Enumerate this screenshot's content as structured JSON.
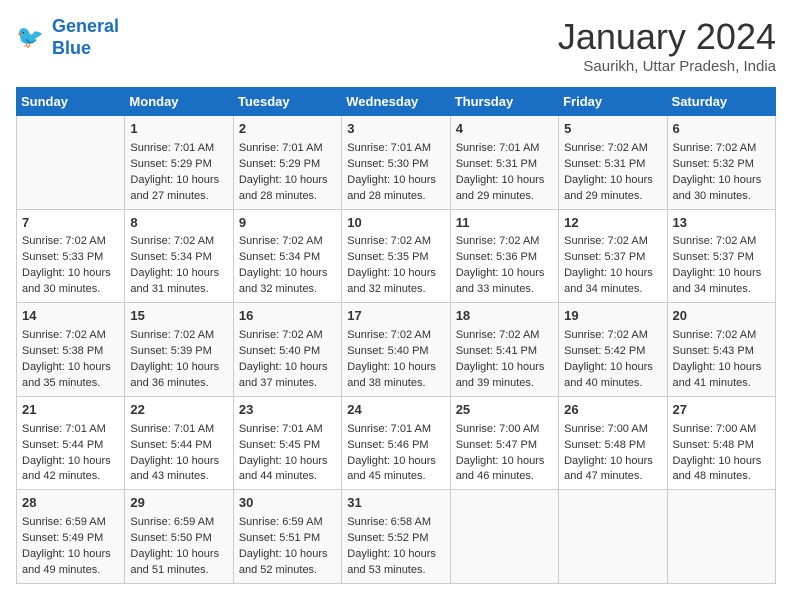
{
  "header": {
    "logo_line1": "General",
    "logo_line2": "Blue",
    "month": "January 2024",
    "location": "Saurikh, Uttar Pradesh, India"
  },
  "weekdays": [
    "Sunday",
    "Monday",
    "Tuesday",
    "Wednesday",
    "Thursday",
    "Friday",
    "Saturday"
  ],
  "weeks": [
    [
      {
        "day": "",
        "info": ""
      },
      {
        "day": "1",
        "info": "Sunrise: 7:01 AM\nSunset: 5:29 PM\nDaylight: 10 hours\nand 27 minutes."
      },
      {
        "day": "2",
        "info": "Sunrise: 7:01 AM\nSunset: 5:29 PM\nDaylight: 10 hours\nand 28 minutes."
      },
      {
        "day": "3",
        "info": "Sunrise: 7:01 AM\nSunset: 5:30 PM\nDaylight: 10 hours\nand 28 minutes."
      },
      {
        "day": "4",
        "info": "Sunrise: 7:01 AM\nSunset: 5:31 PM\nDaylight: 10 hours\nand 29 minutes."
      },
      {
        "day": "5",
        "info": "Sunrise: 7:02 AM\nSunset: 5:31 PM\nDaylight: 10 hours\nand 29 minutes."
      },
      {
        "day": "6",
        "info": "Sunrise: 7:02 AM\nSunset: 5:32 PM\nDaylight: 10 hours\nand 30 minutes."
      }
    ],
    [
      {
        "day": "7",
        "info": "Sunrise: 7:02 AM\nSunset: 5:33 PM\nDaylight: 10 hours\nand 30 minutes."
      },
      {
        "day": "8",
        "info": "Sunrise: 7:02 AM\nSunset: 5:34 PM\nDaylight: 10 hours\nand 31 minutes."
      },
      {
        "day": "9",
        "info": "Sunrise: 7:02 AM\nSunset: 5:34 PM\nDaylight: 10 hours\nand 32 minutes."
      },
      {
        "day": "10",
        "info": "Sunrise: 7:02 AM\nSunset: 5:35 PM\nDaylight: 10 hours\nand 32 minutes."
      },
      {
        "day": "11",
        "info": "Sunrise: 7:02 AM\nSunset: 5:36 PM\nDaylight: 10 hours\nand 33 minutes."
      },
      {
        "day": "12",
        "info": "Sunrise: 7:02 AM\nSunset: 5:37 PM\nDaylight: 10 hours\nand 34 minutes."
      },
      {
        "day": "13",
        "info": "Sunrise: 7:02 AM\nSunset: 5:37 PM\nDaylight: 10 hours\nand 34 minutes."
      }
    ],
    [
      {
        "day": "14",
        "info": "Sunrise: 7:02 AM\nSunset: 5:38 PM\nDaylight: 10 hours\nand 35 minutes."
      },
      {
        "day": "15",
        "info": "Sunrise: 7:02 AM\nSunset: 5:39 PM\nDaylight: 10 hours\nand 36 minutes."
      },
      {
        "day": "16",
        "info": "Sunrise: 7:02 AM\nSunset: 5:40 PM\nDaylight: 10 hours\nand 37 minutes."
      },
      {
        "day": "17",
        "info": "Sunrise: 7:02 AM\nSunset: 5:40 PM\nDaylight: 10 hours\nand 38 minutes."
      },
      {
        "day": "18",
        "info": "Sunrise: 7:02 AM\nSunset: 5:41 PM\nDaylight: 10 hours\nand 39 minutes."
      },
      {
        "day": "19",
        "info": "Sunrise: 7:02 AM\nSunset: 5:42 PM\nDaylight: 10 hours\nand 40 minutes."
      },
      {
        "day": "20",
        "info": "Sunrise: 7:02 AM\nSunset: 5:43 PM\nDaylight: 10 hours\nand 41 minutes."
      }
    ],
    [
      {
        "day": "21",
        "info": "Sunrise: 7:01 AM\nSunset: 5:44 PM\nDaylight: 10 hours\nand 42 minutes."
      },
      {
        "day": "22",
        "info": "Sunrise: 7:01 AM\nSunset: 5:44 PM\nDaylight: 10 hours\nand 43 minutes."
      },
      {
        "day": "23",
        "info": "Sunrise: 7:01 AM\nSunset: 5:45 PM\nDaylight: 10 hours\nand 44 minutes."
      },
      {
        "day": "24",
        "info": "Sunrise: 7:01 AM\nSunset: 5:46 PM\nDaylight: 10 hours\nand 45 minutes."
      },
      {
        "day": "25",
        "info": "Sunrise: 7:00 AM\nSunset: 5:47 PM\nDaylight: 10 hours\nand 46 minutes."
      },
      {
        "day": "26",
        "info": "Sunrise: 7:00 AM\nSunset: 5:48 PM\nDaylight: 10 hours\nand 47 minutes."
      },
      {
        "day": "27",
        "info": "Sunrise: 7:00 AM\nSunset: 5:48 PM\nDaylight: 10 hours\nand 48 minutes."
      }
    ],
    [
      {
        "day": "28",
        "info": "Sunrise: 6:59 AM\nSunset: 5:49 PM\nDaylight: 10 hours\nand 49 minutes."
      },
      {
        "day": "29",
        "info": "Sunrise: 6:59 AM\nSunset: 5:50 PM\nDaylight: 10 hours\nand 51 minutes."
      },
      {
        "day": "30",
        "info": "Sunrise: 6:59 AM\nSunset: 5:51 PM\nDaylight: 10 hours\nand 52 minutes."
      },
      {
        "day": "31",
        "info": "Sunrise: 6:58 AM\nSunset: 5:52 PM\nDaylight: 10 hours\nand 53 minutes."
      },
      {
        "day": "",
        "info": ""
      },
      {
        "day": "",
        "info": ""
      },
      {
        "day": "",
        "info": ""
      }
    ]
  ]
}
